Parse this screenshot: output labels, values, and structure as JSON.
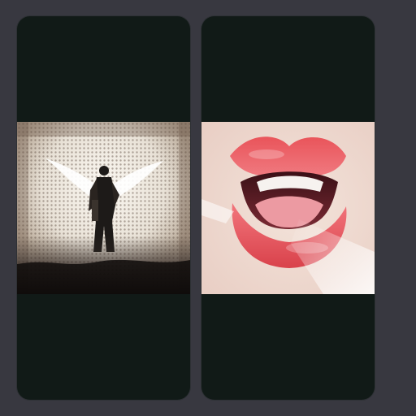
{
  "gallery": {
    "cards": [
      {
        "image_icon": "winged-soldier-grunge-image"
      },
      {
        "image_icon": "red-lips-image"
      }
    ]
  },
  "colors": {
    "background": "#383840",
    "card": "#111a17"
  }
}
